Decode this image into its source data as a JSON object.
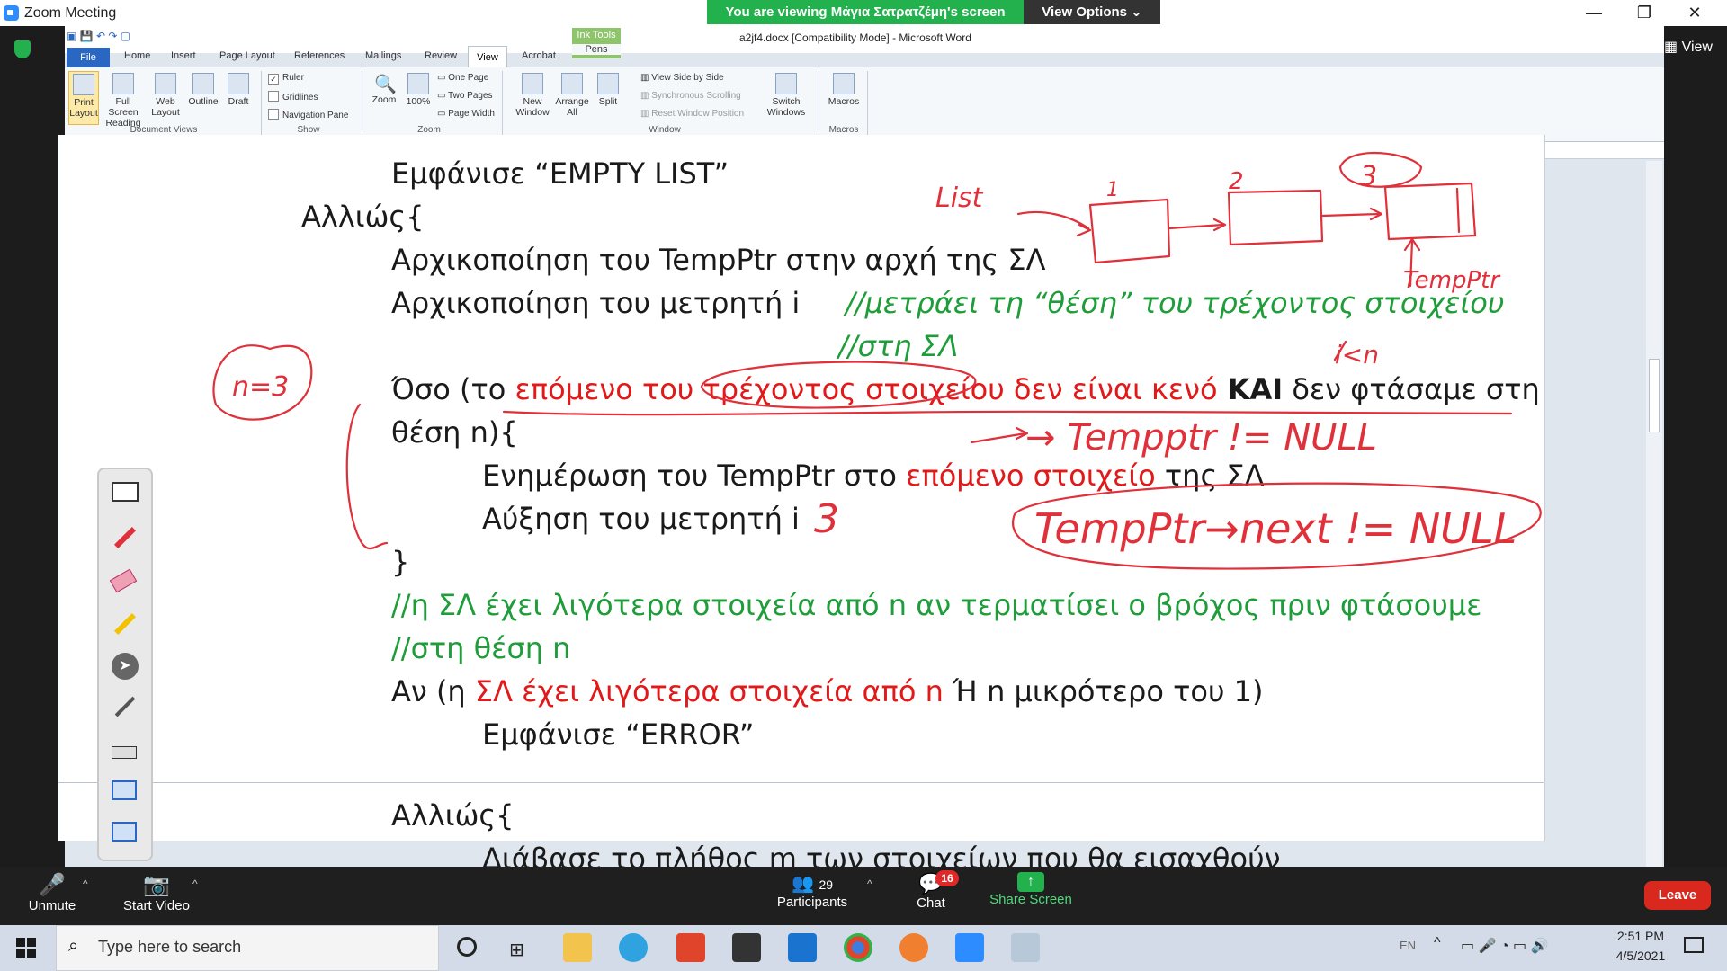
{
  "zoom": {
    "title": "Zoom Meeting",
    "share_banner": "You are viewing Μάγια Σατρατζέμη's screen",
    "view_options": "View Options",
    "view_label": "View",
    "bottom": {
      "unmute": "Unmute",
      "start_video": "Start Video",
      "participants_count": "29",
      "participants": "Participants",
      "chat": "Chat",
      "chat_badge": "16",
      "share_screen": "Share Screen",
      "leave": "Leave"
    }
  },
  "word": {
    "title": "a2jf4.docx [Compatibility Mode] - Microsoft Word",
    "ink_tools": "Ink Tools",
    "pens": "Pens",
    "tabs": [
      "File",
      "Home",
      "Insert",
      "Page Layout",
      "References",
      "Mailings",
      "Review",
      "View",
      "Acrobat"
    ],
    "ribbon": {
      "document_views": {
        "label": "Document Views",
        "items": [
          "Print Layout",
          "Full Screen Reading",
          "Web Layout",
          "Outline",
          "Draft"
        ]
      },
      "show": {
        "label": "Show",
        "ruler": "Ruler",
        "gridlines": "Gridlines",
        "nav_pane": "Navigation Pane"
      },
      "zoom": {
        "label": "Zoom",
        "zoom": "Zoom",
        "pct": "100%",
        "one_page": "One Page",
        "two_pages": "Two Pages",
        "page_width": "Page Width"
      },
      "window": {
        "label": "Window",
        "new_window": "New Window",
        "arrange_all": "Arrange All",
        "split": "Split",
        "side_by_side": "View Side by Side",
        "sync_scroll": "Synchronous Scrolling",
        "reset_pos": "Reset Window Position",
        "switch_windows": "Switch Windows"
      },
      "macros": {
        "label": "Macros",
        "macros": "Macros"
      }
    }
  },
  "doc": {
    "l1": "Εμφάνισε “EMPTY LIST”",
    "l2": "Αλλιώς{",
    "l3": "Αρχικοποίηση του TempPtr στην αρχή της ΣΛ",
    "l4a": "Αρχικοποίηση του μετρητή i",
    "l4b": "//μετράει τη “θέση” του τρέχοντος στοιχείου",
    "l5": "//στη ΣΛ",
    "l6a": "Όσο (το ",
    "l6b": "επόμενο του τρέχοντος στοιχείου δεν είναι κενό",
    "l6c": " ΚΑΙ",
    "l6d": " δεν φτάσαμε στη",
    "l7": "θέση n){",
    "l8a": "Ενημέρωση του TempPtr στο ",
    "l8b": "επόμενο στοιχείο",
    "l8c": " της ΣΛ",
    "l9": "Αύξηση του μετρητή i",
    "l10": "}",
    "l11": "//η ΣΛ έχει λιγότερα στοιχεία από n αν τερματίσει ο βρόχος πριν φτάσουμε",
    "l12": "//στη θέση n",
    "l13a": "Αν (η ",
    "l13b": "ΣΛ έχει λιγότερα στοιχεία από n",
    "l13c": " Ή n μικρότερο του 1)",
    "l14": "Εμφάνισε “ERROR”",
    "l15": "Αλλιώς{",
    "l16": "Διάβασε το πλήθος m των στοιχείων που θα εισαχθούν"
  },
  "ink": {
    "list": "List",
    "n1": "1",
    "n2": "2",
    "n3": "3",
    "tempptr": "TempPtr",
    "n_eq": "n=3",
    "le_n": "i<n",
    "tempptr_null": "→ Tempptr != NULL",
    "next_null": "TempPtr→next != NULL",
    "i3": "3"
  },
  "taskbar": {
    "search": "Type here to search",
    "time": "2:51 PM",
    "date": "4/5/2021",
    "lang": "EN"
  },
  "colors": {
    "ink_red": "#e0303a",
    "zoom_green": "#23b14d",
    "word_blue": "#2a67c3"
  }
}
